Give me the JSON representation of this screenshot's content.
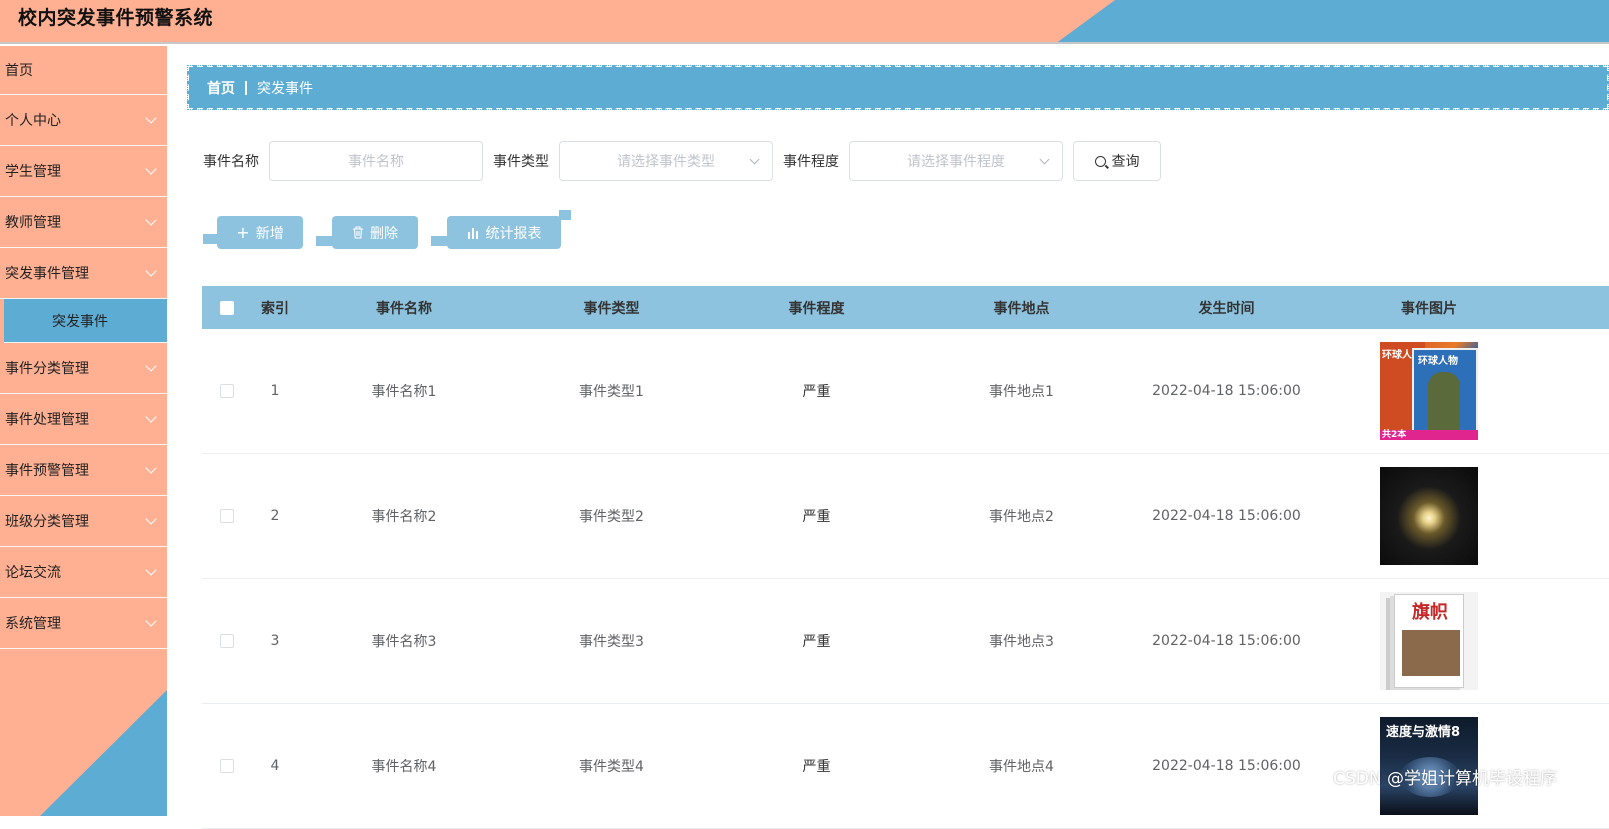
{
  "app": {
    "title": "校内突发事件预警系统"
  },
  "sidebar": {
    "items": [
      {
        "label": "首页",
        "has_children": false
      },
      {
        "label": "个人中心",
        "has_children": true
      },
      {
        "label": "学生管理",
        "has_children": true
      },
      {
        "label": "教师管理",
        "has_children": true
      },
      {
        "label": "突发事件管理",
        "has_children": true,
        "expanded": true
      },
      {
        "label": "事件分类管理",
        "has_children": true
      },
      {
        "label": "事件处理管理",
        "has_children": true
      },
      {
        "label": "事件预警管理",
        "has_children": true
      },
      {
        "label": "班级分类管理",
        "has_children": true
      },
      {
        "label": "论坛交流",
        "has_children": true
      },
      {
        "label": "系统管理",
        "has_children": true
      }
    ],
    "active_subitem": "突发事件"
  },
  "breadcrumb": {
    "home": "首页",
    "current": "突发事件"
  },
  "search": {
    "name_label": "事件名称",
    "name_placeholder": "事件名称",
    "type_label": "事件类型",
    "type_placeholder": "请选择事件类型",
    "level_label": "事件程度",
    "level_placeholder": "请选择事件程度",
    "query_button": "查询"
  },
  "actions": {
    "add": "新增",
    "delete": "删除",
    "report": "统计报表"
  },
  "table": {
    "columns": [
      "索引",
      "事件名称",
      "事件类型",
      "事件程度",
      "事件地点",
      "发生时间",
      "事件图片"
    ],
    "rows": [
      {
        "index": "1",
        "name": "事件名称1",
        "type": "事件类型1",
        "level": "严重",
        "place": "事件地点1",
        "time": "2022-04-18 15:06:00",
        "image": "magazine-covers-image"
      },
      {
        "index": "2",
        "name": "事件名称2",
        "type": "事件类型2",
        "level": "严重",
        "place": "事件地点2",
        "time": "2022-04-18 15:06:00",
        "image": "lightbulb-image"
      },
      {
        "index": "3",
        "name": "事件名称3",
        "type": "事件类型3",
        "level": "严重",
        "place": "事件地点3",
        "time": "2022-04-18 15:06:00",
        "image": "magazine-stack-image"
      },
      {
        "index": "4",
        "name": "事件名称4",
        "type": "事件类型4",
        "level": "严重",
        "place": "事件地点4",
        "time": "2022-04-18 15:06:00",
        "image": "speed-magazine-image"
      }
    ]
  },
  "image_text": {
    "row1_left": "环球人",
    "row1_right": "环球人物",
    "row1_bottom": "共2本",
    "row3_masthead": "旗帜",
    "row4_masthead": "速度与激情8"
  },
  "watermark": "CSDN @学姐计算机毕设程序",
  "colors": {
    "salmon": "#ffb093",
    "blue": "#5dacd3",
    "table_header": "#8dc3df"
  }
}
